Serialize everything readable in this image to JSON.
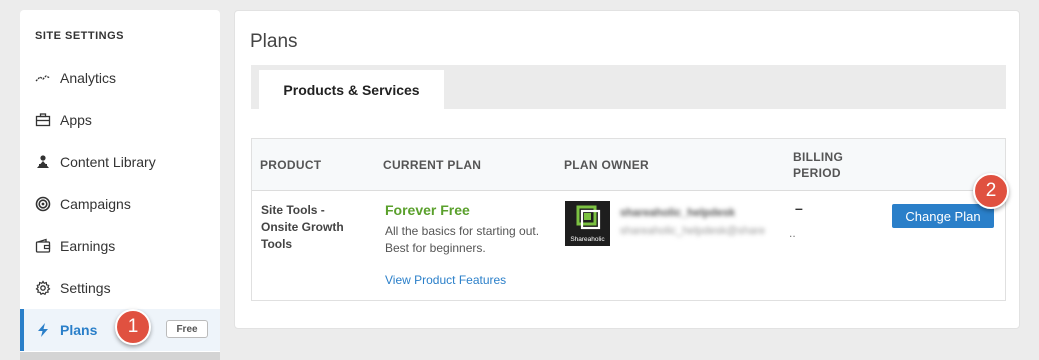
{
  "sidebar": {
    "heading": "SITE SETTINGS",
    "items": [
      {
        "label": "Analytics",
        "icon": "analytics-icon"
      },
      {
        "label": "Apps",
        "icon": "briefcase-icon"
      },
      {
        "label": "Content Library",
        "icon": "content-library-icon"
      },
      {
        "label": "Campaigns",
        "icon": "target-icon"
      },
      {
        "label": "Earnings",
        "icon": "wallet-icon"
      },
      {
        "label": "Settings",
        "icon": "gear-icon"
      },
      {
        "label": "Plans",
        "icon": "lightning-icon",
        "badge": "Free",
        "active": true
      }
    ]
  },
  "main": {
    "title": "Plans",
    "tab": "Products & Services",
    "columns": [
      "PRODUCT",
      "CURRENT PLAN",
      "PLAN OWNER",
      "BILLING PERIOD"
    ],
    "row": {
      "product": "Site Tools - Onsite Growth Tools",
      "plan_name": "Forever Free",
      "plan_desc": "All the basics for starting out. Best for beginners.",
      "view_features": "View Product Features",
      "owner_logo_text": "Shareaholic",
      "owner_name": "shareaholic_helpdesk",
      "owner_email": "shareaholic_helpdesk@share",
      "owner_ellipsis": "..",
      "billing_period": "–",
      "action": "Change Plan"
    }
  },
  "callouts": [
    "1",
    "2"
  ],
  "colors": {
    "accent": "#2a7fc9",
    "plan_green": "#5aa02c",
    "callout": "#e05140"
  }
}
